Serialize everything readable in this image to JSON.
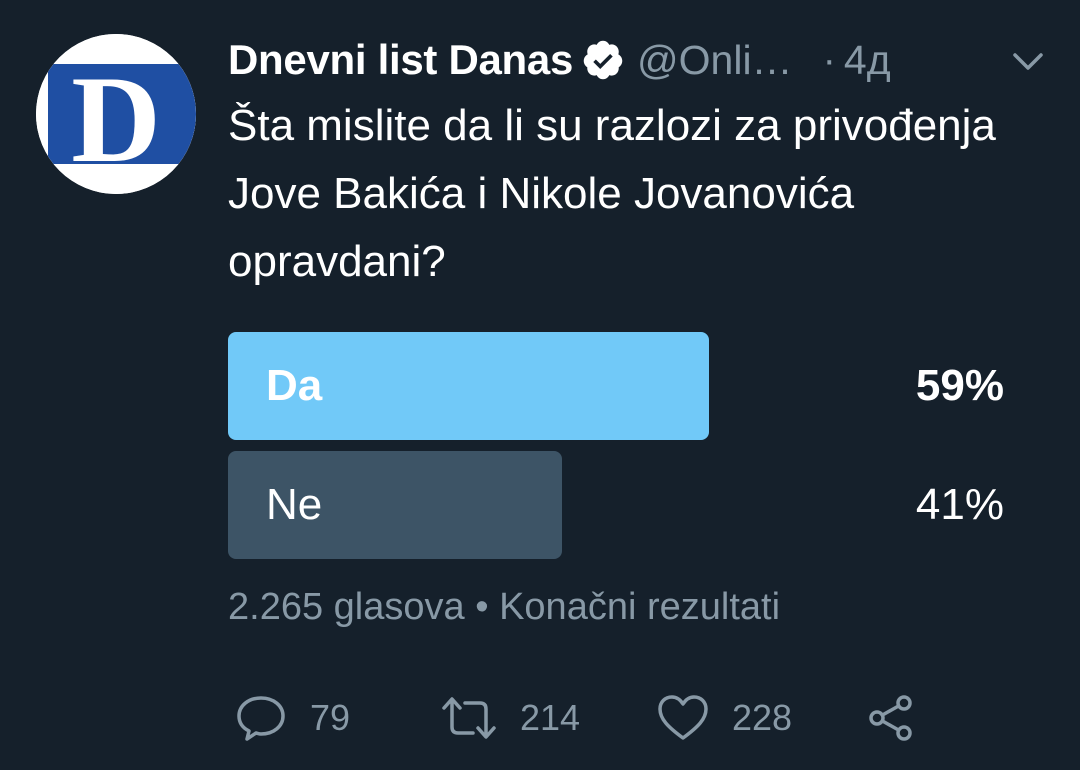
{
  "account": {
    "display_name": "Dnevni list Danas",
    "handle": "@Onli…",
    "separator": "·",
    "time": "4д",
    "avatar_letter": "D"
  },
  "tweet": {
    "text": "Šta mislite da li su razlozi za privođenja Jove Bakića i Nikole Jovanovića opravdani?"
  },
  "poll": {
    "options": [
      {
        "label": "Da",
        "percent_text": "59%",
        "percent": 59,
        "winner": true
      },
      {
        "label": "Ne",
        "percent_text": "41%",
        "percent": 41,
        "winner": false
      }
    ],
    "votes": "2.265 glasova",
    "meta_separator": "•",
    "status": "Konačni rezultati"
  },
  "actions": {
    "replies": "79",
    "retweets": "214",
    "likes": "228"
  },
  "colors": {
    "background": "#15202b",
    "winner_bar": "#71c9f8",
    "loser_bar": "#3d5466",
    "muted_text": "#8899a6",
    "avatar_brand": "#1f4fa3"
  },
  "icons": {
    "verified": "verified-badge-icon",
    "menu": "chevron-down-icon",
    "reply": "reply-icon",
    "retweet": "retweet-icon",
    "like": "heart-icon",
    "share": "share-icon"
  }
}
